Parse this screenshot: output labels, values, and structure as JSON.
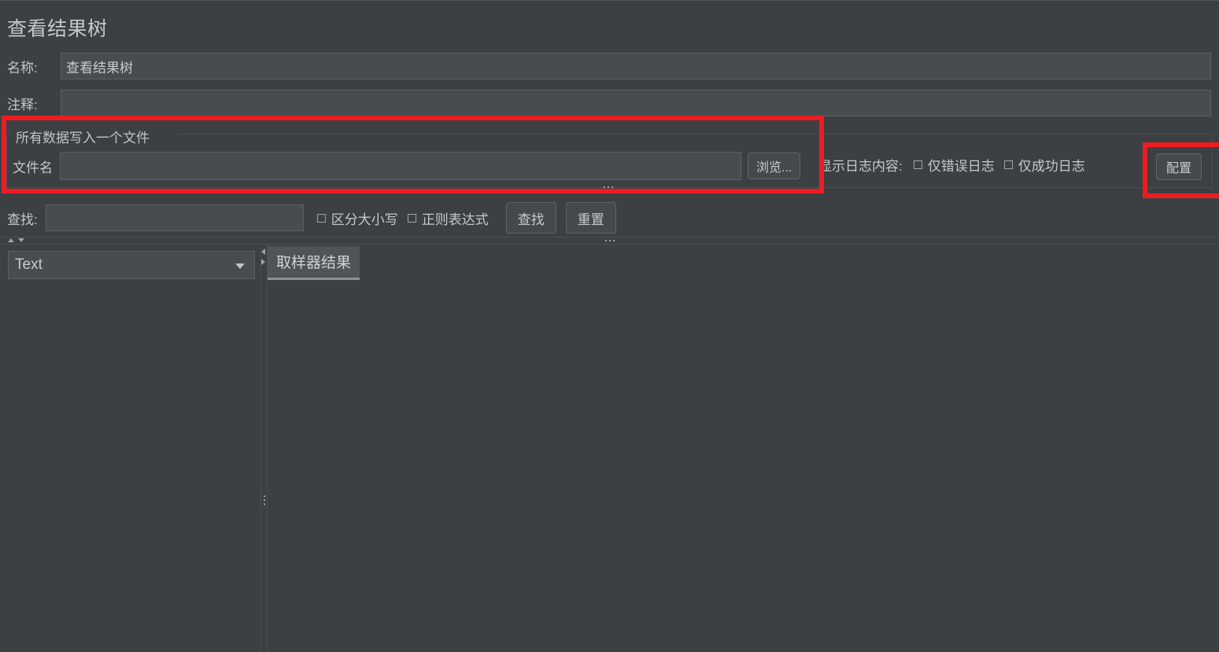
{
  "window": {
    "title": "查看结果树"
  },
  "form": {
    "name_label": "名称:",
    "name_value": "查看结果树",
    "comment_label": "注释:",
    "comment_value": "",
    "comment_placeholder": ""
  },
  "file_panel": {
    "title": "所有数据写入一个文件",
    "filename_label": "文件名",
    "filename_value": "",
    "filename_placeholder": "",
    "browse_label": "浏览...",
    "log_display_label": "显示日志内容:",
    "checkboxes": [
      {
        "label": "仅错误日志",
        "checked": false
      },
      {
        "label": "仅成功日志",
        "checked": false
      }
    ],
    "config_label": "配置"
  },
  "search": {
    "label": "查找:",
    "value": "",
    "placeholder": "",
    "checkboxes": [
      {
        "label": "区分大小写",
        "checked": false
      },
      {
        "label": "正则表达式",
        "checked": false
      }
    ],
    "find_label": "查找",
    "reset_label": "重置"
  },
  "lower": {
    "renderer_selected": "Text",
    "tabs": [
      {
        "label": "取样器结果",
        "selected": true
      }
    ]
  },
  "icons": {
    "browse_icon": "ellipsis-icon",
    "caret": "chevron-down-icon",
    "splitter_up": "triangle-up-icon",
    "splitter_down": "triangle-down-icon",
    "splitter_left": "triangle-left-icon",
    "splitter_right": "triangle-right-icon"
  },
  "colors": {
    "background": "#3c4043",
    "field": "#474c4f",
    "text": "#c5c8ca",
    "annotation_red": "#ee1c22",
    "tab_selected": "#4f5457"
  }
}
